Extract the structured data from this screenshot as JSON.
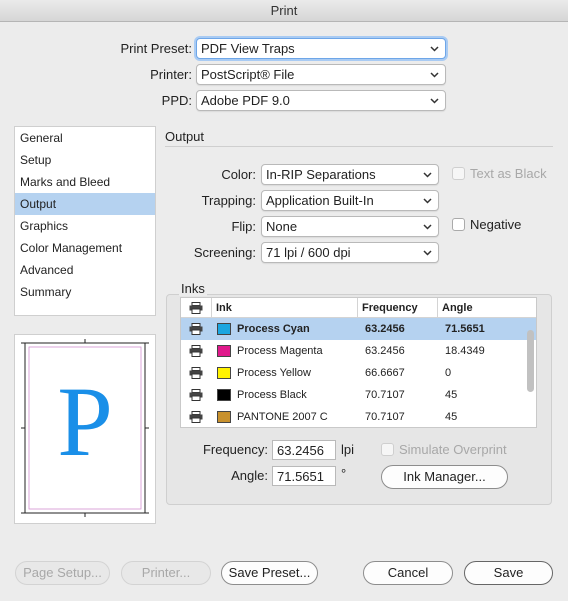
{
  "window": {
    "title": "Print"
  },
  "header": {
    "preset_label": "Print Preset:",
    "preset_value": "PDF View Traps",
    "printer_label": "Printer:",
    "printer_value": "PostScript® File",
    "ppd_label": "PPD:",
    "ppd_value": "Adobe PDF 9.0"
  },
  "sidebar": {
    "items": [
      {
        "label": "General"
      },
      {
        "label": "Setup"
      },
      {
        "label": "Marks and Bleed"
      },
      {
        "label": "Output",
        "selected": true
      },
      {
        "label": "Graphics"
      },
      {
        "label": "Color Management"
      },
      {
        "label": "Advanced"
      },
      {
        "label": "Summary"
      }
    ]
  },
  "preview": {
    "glyph": "P",
    "glyph_color": "#1a8fe8"
  },
  "output": {
    "title": "Output",
    "color_label": "Color:",
    "color_value": "In-RIP Separations",
    "text_as_black_label": "Text as Black",
    "trapping_label": "Trapping:",
    "trapping_value": "Application Built-In",
    "flip_label": "Flip:",
    "flip_value": "None",
    "negative_label": "Negative",
    "screening_label": "Screening:",
    "screening_value": "71 lpi / 600 dpi"
  },
  "inks": {
    "title": "Inks",
    "columns": [
      "Ink",
      "Frequency",
      "Angle"
    ],
    "rows": [
      {
        "name": "Process Cyan",
        "frequency": "63.2456",
        "angle": "71.5651",
        "color": "#1ba6e0",
        "selected": true
      },
      {
        "name": "Process Magenta",
        "frequency": "63.2456",
        "angle": "18.4349",
        "color": "#e0198c"
      },
      {
        "name": "Process Yellow",
        "frequency": "66.6667",
        "angle": "0",
        "color": "#fff200"
      },
      {
        "name": "Process Black",
        "frequency": "70.7107",
        "angle": "45",
        "color": "#000000"
      },
      {
        "name": "PANTONE 2007 C",
        "frequency": "70.7107",
        "angle": "45",
        "color": "#c8912d"
      }
    ],
    "frequency_label": "Frequency:",
    "frequency_value": "63.2456",
    "frequency_unit": "lpi",
    "angle_label": "Angle:",
    "angle_value": "71.5651",
    "angle_unit": "°",
    "simulate_overprint_label": "Simulate Overprint",
    "ink_manager_label": "Ink Manager..."
  },
  "footer": {
    "page_setup_label": "Page Setup...",
    "printer_label": "Printer...",
    "save_preset_label": "Save Preset...",
    "cancel_label": "Cancel",
    "save_label": "Save"
  }
}
